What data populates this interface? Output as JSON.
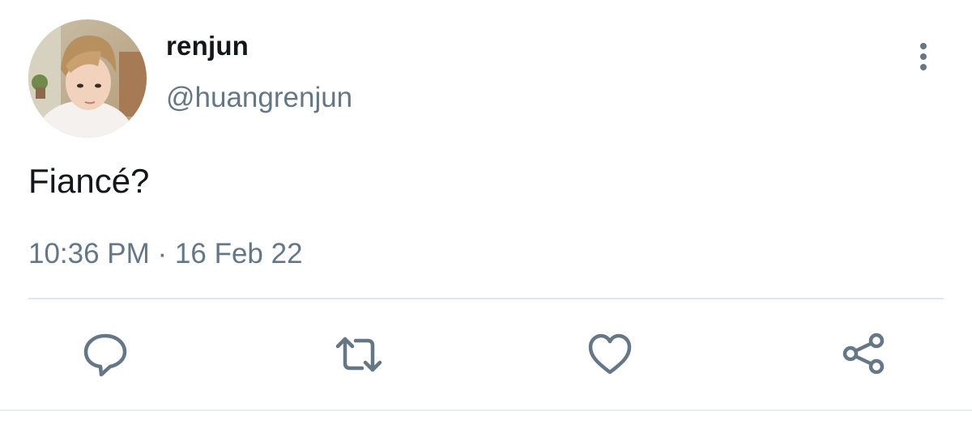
{
  "tweet": {
    "author": {
      "display_name": "renjun",
      "handle": "@huangrenjun",
      "avatar_icon": "profile-photo"
    },
    "text": "Fiancé?",
    "timestamp": "10:36 PM · 16 Feb 22"
  },
  "actions": {
    "more": "more-options-icon",
    "reply": "reply-icon",
    "retweet": "retweet-icon",
    "like": "like-icon",
    "share": "share-icon"
  },
  "colors": {
    "text_primary": "#14171a",
    "text_secondary": "#657786",
    "icon": "#657786",
    "divider": "#e1e8ed"
  }
}
